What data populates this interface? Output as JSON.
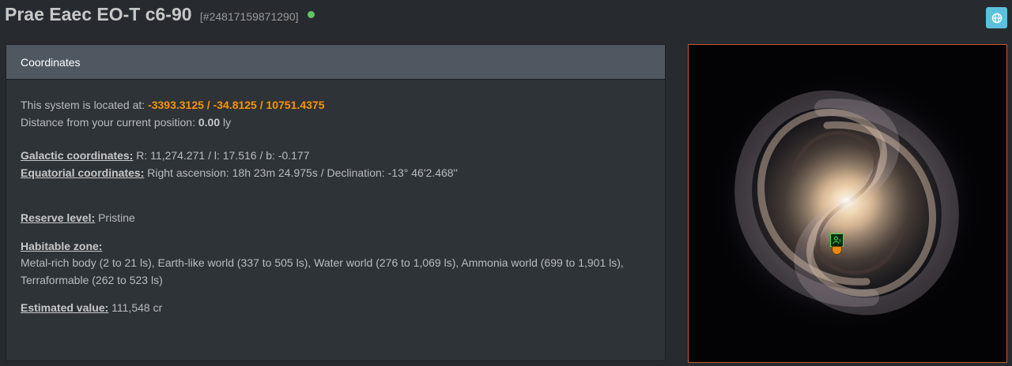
{
  "header": {
    "system_name": "Prae Eaec EO-T c6-90",
    "system_id": "[#24817159871290]",
    "status_color": "#62c462",
    "globe_icon": "globe-icon"
  },
  "panel": {
    "title": "Coordinates",
    "located_label": "This system is located at: ",
    "located_value": "-3393.3125 / -34.8125 / 10751.4375",
    "distance_label": "Distance from your current position: ",
    "distance_value": "0.00",
    "distance_unit": " ly",
    "galactic_label": "Galactic coordinates:",
    "galactic_value": " R: 11,274.271 / l: 17.516 / b: -0.177",
    "equatorial_label": "Equatorial coordinates:",
    "equatorial_value": " Right ascension: 18h 23m 24.975s / Declination: -13° 46'2.468''",
    "reserve_label": "Reserve level:",
    "reserve_value": " Pristine",
    "habitable_label": "Habitable zone:",
    "habitable_line1": "Metal-rich body (2 to 21 ls), Earth-like world (337 to 505 ls), Water world (276 to 1,069 ls), Ammonia world (699 to 1,901 ls),",
    "habitable_line2": "Terraformable (262 to 523 ls)",
    "estimated_label": "Estimated value:",
    "estimated_value": " 111,548 cr"
  },
  "map": {
    "frame_color": "#c2562c",
    "marker_icon": "user-location-icon",
    "marker_color": "#3ddc4a",
    "pin_color": "#e68a12"
  }
}
